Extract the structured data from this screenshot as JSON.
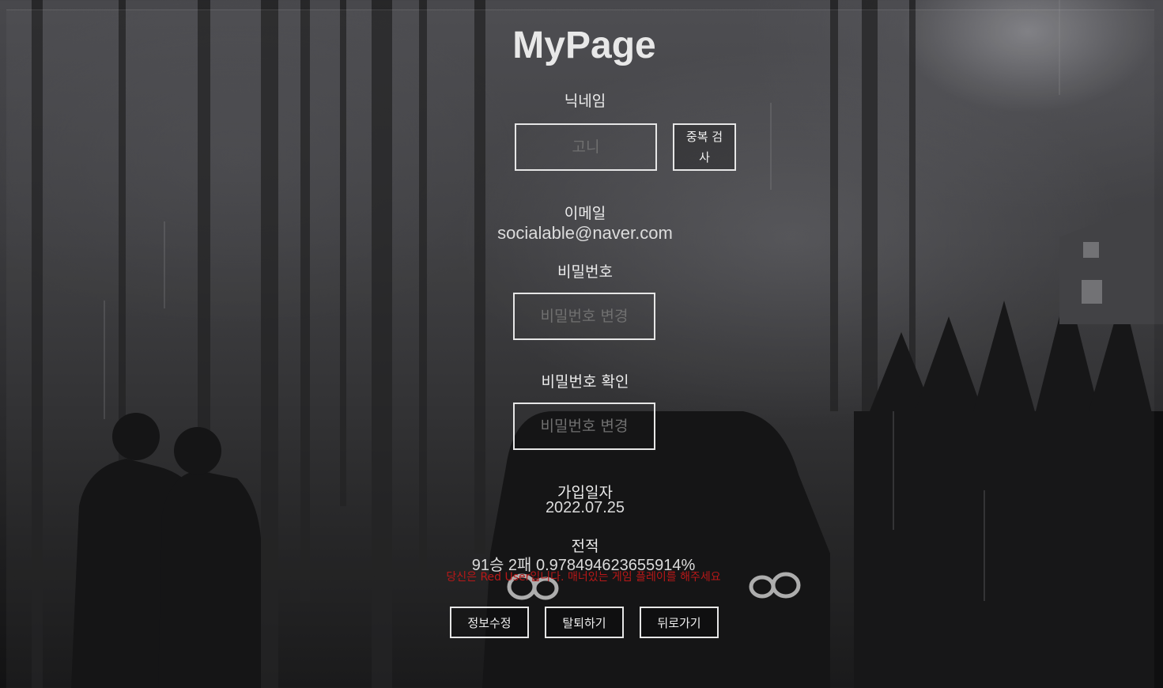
{
  "page": {
    "title": "MyPage"
  },
  "nickname": {
    "label": "닉네임",
    "placeholder": "고니",
    "check_button": "중복 검사"
  },
  "email": {
    "label": "이메일",
    "value": "socialable@naver.com"
  },
  "password": {
    "label": "비밀번호",
    "placeholder": "비밀번호 변경"
  },
  "password_confirm": {
    "label": "비밀번호 확인",
    "placeholder": "비밀번호 변경"
  },
  "join_date": {
    "label": "가입일자",
    "value": "2022.07.25"
  },
  "record": {
    "label": "전적",
    "value": "91승 2패 0.978494623655914%",
    "warning": "당신은 Red User입니다. 매너있는 게임 플레이를 해주세요"
  },
  "actions": {
    "edit": "정보수정",
    "withdraw": "탈퇴하기",
    "back": "뒤로가기"
  },
  "colors": {
    "warning": "#b81818",
    "border": "#e6e6e6"
  }
}
